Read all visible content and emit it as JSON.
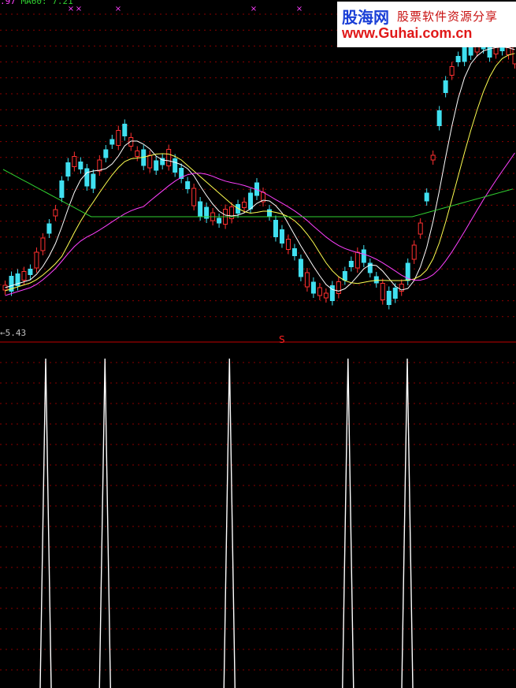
{
  "header": {
    "ma_prefix": ".97",
    "ma_label": "MA60: 7.21"
  },
  "watermark": {
    "title_cn": "股海网",
    "slogan_cn": "股票软件资源分享",
    "url": "www.Guhai.com.cn"
  },
  "labels": {
    "low_price": "5.43",
    "signal_marker": "S"
  },
  "colors": {
    "up": "#ff3030",
    "down": "#40e0f0",
    "ma5": "#ffffff",
    "ma10": "#ffff50",
    "ma30": "#ff40ff",
    "ma60": "#30d030",
    "grid": "#8a0000",
    "signal": "#ffffff",
    "cross": "#ff40ff"
  },
  "chart_data": [
    {
      "type": "candlestick",
      "series": [
        {
          "name": "MA60",
          "values": [
            7.21
          ]
        }
      ],
      "low_marker": 5.43
    },
    {
      "type": "line",
      "spikes_at_candle_index": [
        9,
        19,
        40,
        60,
        70
      ]
    }
  ]
}
